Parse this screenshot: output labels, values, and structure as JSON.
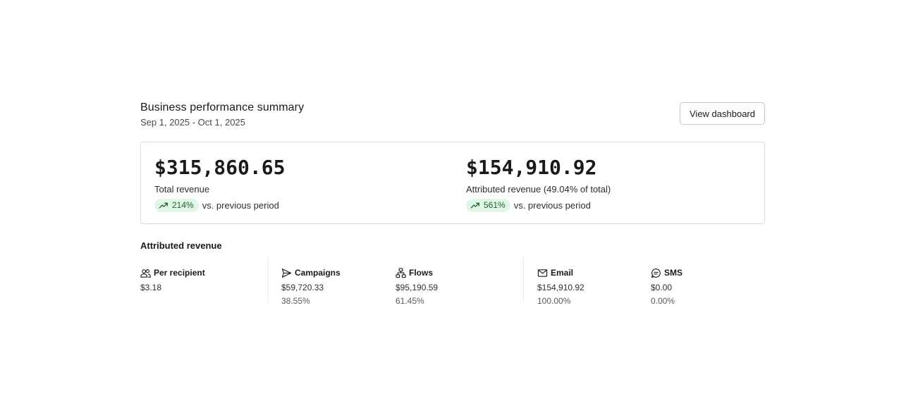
{
  "header": {
    "title": "Business performance summary",
    "date_range": "Sep 1, 2025 - Oct 1, 2025",
    "view_button": "View dashboard"
  },
  "kpis": [
    {
      "value": "$315,860.65",
      "label": "Total revenue",
      "change": "214%",
      "change_suffix": "vs. previous period",
      "trend_icon": "trending-up-icon"
    },
    {
      "value": "$154,910.92",
      "label": "Attributed revenue (49.04% of total)",
      "change": "561%",
      "change_suffix": "vs. previous period",
      "trend_icon": "trending-up-icon"
    }
  ],
  "attributed": {
    "title": "Attributed revenue",
    "metrics": [
      {
        "icon": "people-icon",
        "label": "Per recipient",
        "value": "$3.18",
        "pct": ""
      },
      {
        "icon": "send-icon",
        "label": "Campaigns",
        "value": "$59,720.33",
        "pct": "38.55%"
      },
      {
        "icon": "flows-icon",
        "label": "Flows",
        "value": "$95,190.59",
        "pct": "61.45%"
      },
      {
        "icon": "mail-icon",
        "label": "Email",
        "value": "$154,910.92",
        "pct": "100.00%"
      },
      {
        "icon": "chat-icon",
        "label": "SMS",
        "value": "$0.00",
        "pct": "0.00%"
      }
    ]
  },
  "colors": {
    "badge_bg": "#e2f6e8",
    "badge_text": "#1f5f37",
    "border": "#dcdcdc"
  }
}
